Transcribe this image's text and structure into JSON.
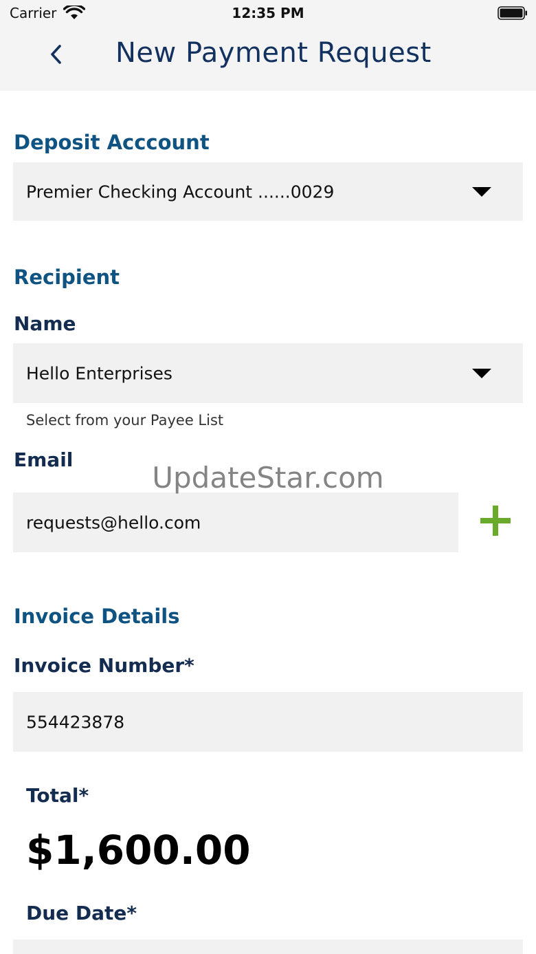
{
  "status_bar": {
    "carrier": "Carrier",
    "time": "12:35 PM",
    "wifi_icon": "wifi-icon",
    "battery_icon": "battery-full-icon"
  },
  "nav": {
    "title": "New Payment Request",
    "back_icon": "chevron-left-icon"
  },
  "deposit_account": {
    "heading": "Deposit Acccount",
    "selected": "Premier Checking Account ......0029"
  },
  "recipient": {
    "heading": "Recipient",
    "name_label": "Name",
    "name_value": "Hello Enterprises",
    "name_helper": "Select from your Payee List",
    "email_label": "Email",
    "email_value": "requests@hello.com",
    "add_icon": "plus-icon"
  },
  "invoice": {
    "heading": "Invoice Details",
    "number_label": "Invoice Number*",
    "number_value": "554423878",
    "total_label": "Total*",
    "total_value": "$1,600.00",
    "due_date_label": "Due Date*"
  },
  "watermark": "UpdateStar.com",
  "colors": {
    "section_heading": "#0f5382",
    "field_label": "#132c4f",
    "field_background": "#f1f1f1",
    "add_accent": "#6aaa2a"
  }
}
